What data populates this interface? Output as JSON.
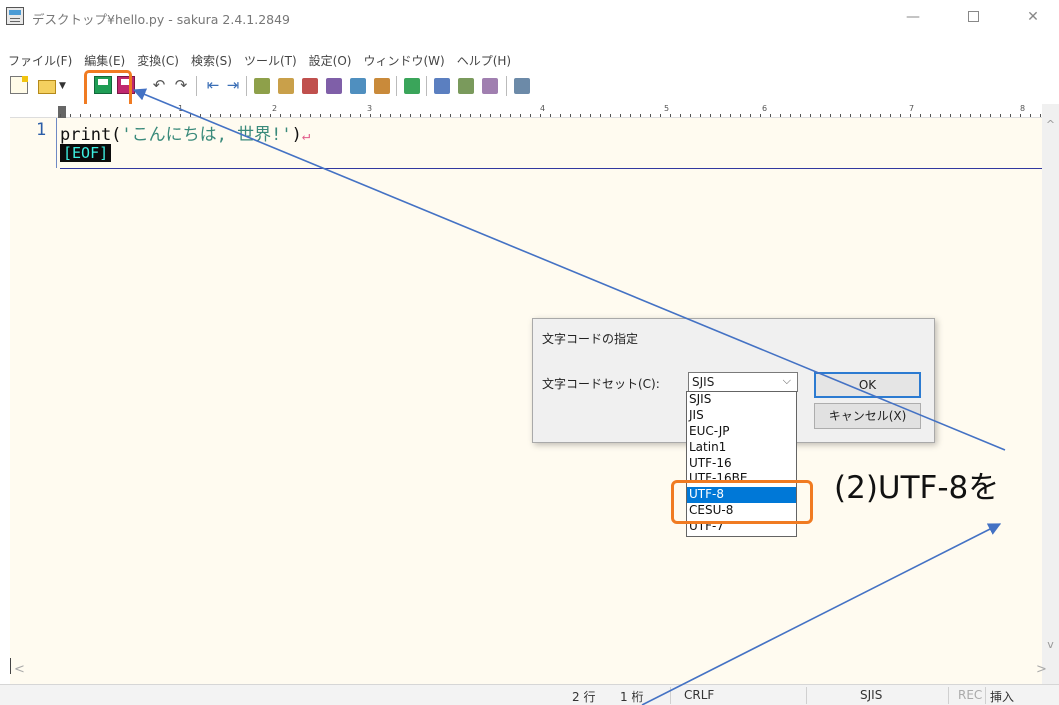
{
  "window": {
    "title": "デスクトップ¥hello.py - sakura 2.4.1.2849",
    "min_symbol": "—",
    "close_symbol": "✕"
  },
  "menu": [
    {
      "label": "ファイル(F)"
    },
    {
      "label": "編集(E)"
    },
    {
      "label": "変換(C)"
    },
    {
      "label": "検索(S)"
    },
    {
      "label": "ツール(T)"
    },
    {
      "label": "設定(O)"
    },
    {
      "label": "ウィンドウ(W)"
    },
    {
      "label": "ヘルプ(H)"
    }
  ],
  "ruler": {
    "labels": [
      "1",
      "2",
      "3",
      "4",
      "5",
      "6",
      "7",
      "8"
    ]
  },
  "editor": {
    "line_number": "1",
    "code_fn": "print(",
    "code_str": "'こんにちは, 世界!'",
    "code_close": ")",
    "eol_mark": "↵",
    "eof_marker": "[EOF]"
  },
  "statusbar": {
    "position_line": "2 行",
    "position_col": "1 桁",
    "line_ending": "CRLF",
    "encoding": "SJIS",
    "rec": "REC",
    "insert_mode": "挿入"
  },
  "dialog": {
    "title": "文字コードの指定",
    "charset_label": "文字コードセット(C):",
    "selected_value": "SJIS",
    "ok_label": "OK",
    "cancel_label": "キャンセル(X)",
    "options": [
      "SJIS",
      "JIS",
      "EUC-JP",
      "Latin1",
      "UTF-16",
      "UTF-16BE",
      "UTF-8",
      "CESU-8",
      "UTF-7"
    ],
    "highlighted_option": "UTF-8"
  },
  "annotation": {
    "callout_text": "(2)UTF-8を"
  },
  "colors": {
    "highlight_box": "#f07b22",
    "arrow": "#4472c4",
    "selected_option_bg": "#0078d7",
    "editor_bg": "#fffbf0"
  }
}
